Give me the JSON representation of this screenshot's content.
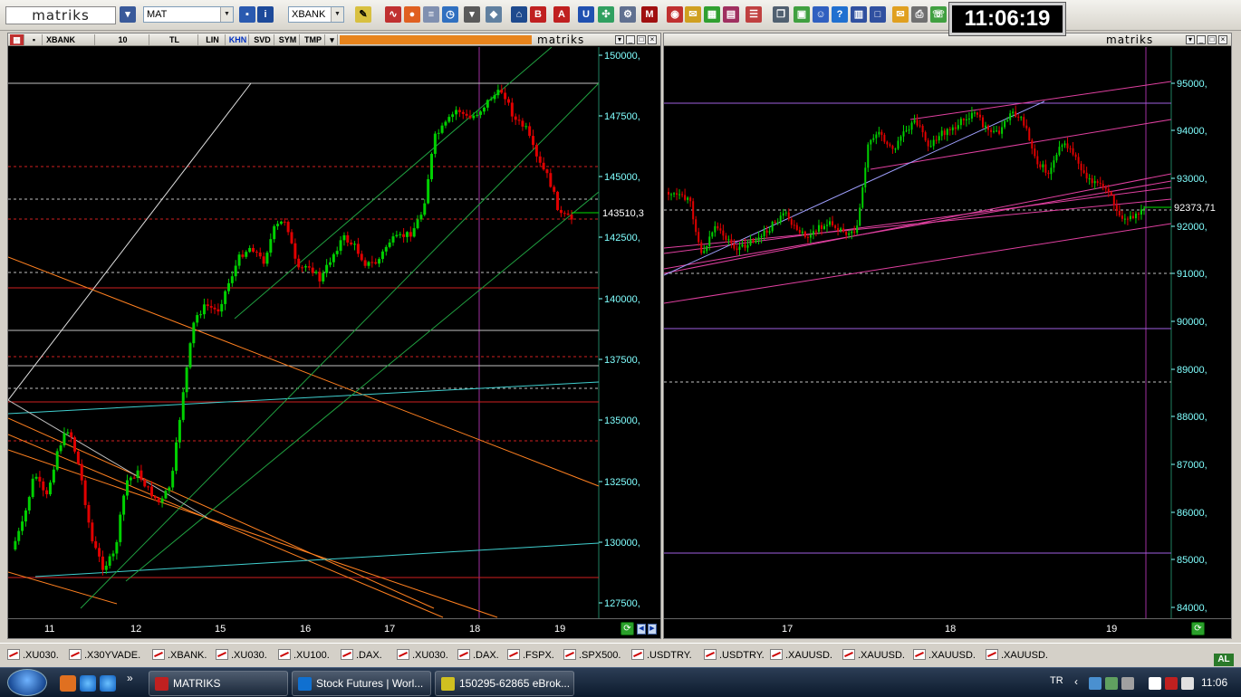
{
  "app": {
    "logo": "matriks",
    "toolbar": {
      "indicator_combo": "MAT",
      "symbol_combo": "XBANK",
      "clock": "11:06:19"
    }
  },
  "left_panel": {
    "header": {
      "symbol": "XBANK",
      "period": "10",
      "currency": "TL",
      "scale": "LIN",
      "active_btn": "KHN",
      "btn_svd": "SVD",
      "btn_sym": "SYM",
      "btn_tmp": "TMP",
      "brand": "matriks"
    },
    "price_labels": [
      "150000,",
      "147500,",
      "145000,",
      "142500,",
      "140000,",
      "137500,",
      "135000,",
      "132500,",
      "130000,",
      "127500,"
    ],
    "current_price": "143510,3",
    "x_ticks": [
      "11",
      "12",
      "15",
      "16",
      "17",
      "18",
      "19"
    ]
  },
  "right_panel": {
    "header": {
      "brand": "matriks"
    },
    "price_labels": [
      "95000,",
      "94000,",
      "93000,",
      "92000,",
      "91000,",
      "90000,",
      "89000,",
      "88000,",
      "87000,",
      "86000,",
      "85000,",
      "84000,"
    ],
    "current_price": "92373,71",
    "x_ticks": [
      "17",
      "18",
      "19"
    ]
  },
  "symbol_tabs": [
    ".XU030.",
    ".X30YVADE.",
    ".XBANK.",
    ".XU030.",
    ".XU100.",
    ".DAX.",
    ".XU030.",
    ".DAX.",
    ".FSPX.",
    ".SPX500.",
    ".USDTRY.",
    ".USDTRY.",
    ".XAUUSD.",
    ".XAUUSD.",
    ".XAUUSD.",
    ".XAUUSD."
  ],
  "al_badge": "AL",
  "taskbar": {
    "tasks": [
      "MATRIKS",
      "Stock Futures | Worl...",
      "150295-62865 eBrok..."
    ],
    "language": "TR",
    "time": "11:06"
  },
  "colors": {
    "chart_bg": "#000000",
    "bull": "#00d000",
    "bear": "#e00000",
    "axis_text": "#80ffff",
    "clock_bg": "#000000",
    "accent_bar": "#e8841c"
  }
}
